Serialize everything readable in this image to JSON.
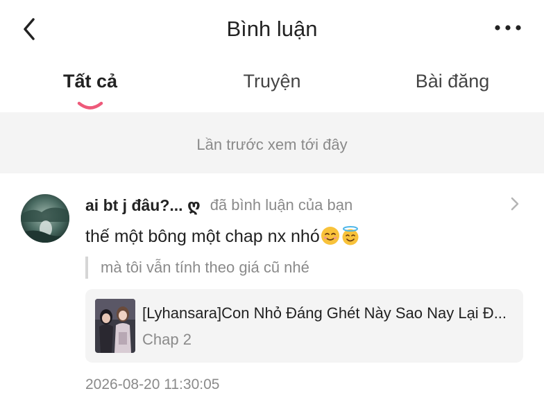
{
  "header": {
    "title": "Bình luận",
    "back_icon": "chevron-left-icon",
    "more_icon": "more-horizontal-icon"
  },
  "tabs": [
    {
      "label": "Tất cả",
      "active": true
    },
    {
      "label": "Truyện",
      "active": false
    },
    {
      "label": "Bài đăng",
      "active": false
    }
  ],
  "accent_color": "#ee5a7a",
  "divider_text": "Lần trước xem tới đây",
  "comment": {
    "username": "ai bt j đâu?... ღ",
    "action": "đã bình luận của bạn",
    "text": "thế một bông một chap nx nhó",
    "emojis": [
      "smiling-face-emoji",
      "halo-face-emoji"
    ],
    "quote": "mà tôi vẫn tính theo giá cũ nhé",
    "story": {
      "title": "[Lyhansara]Con Nhỏ Đáng Ghét Này Sao Nay Lại Đ...",
      "chapter": "Chap 2"
    },
    "timestamp": "2026-08-20 11:30:05"
  }
}
